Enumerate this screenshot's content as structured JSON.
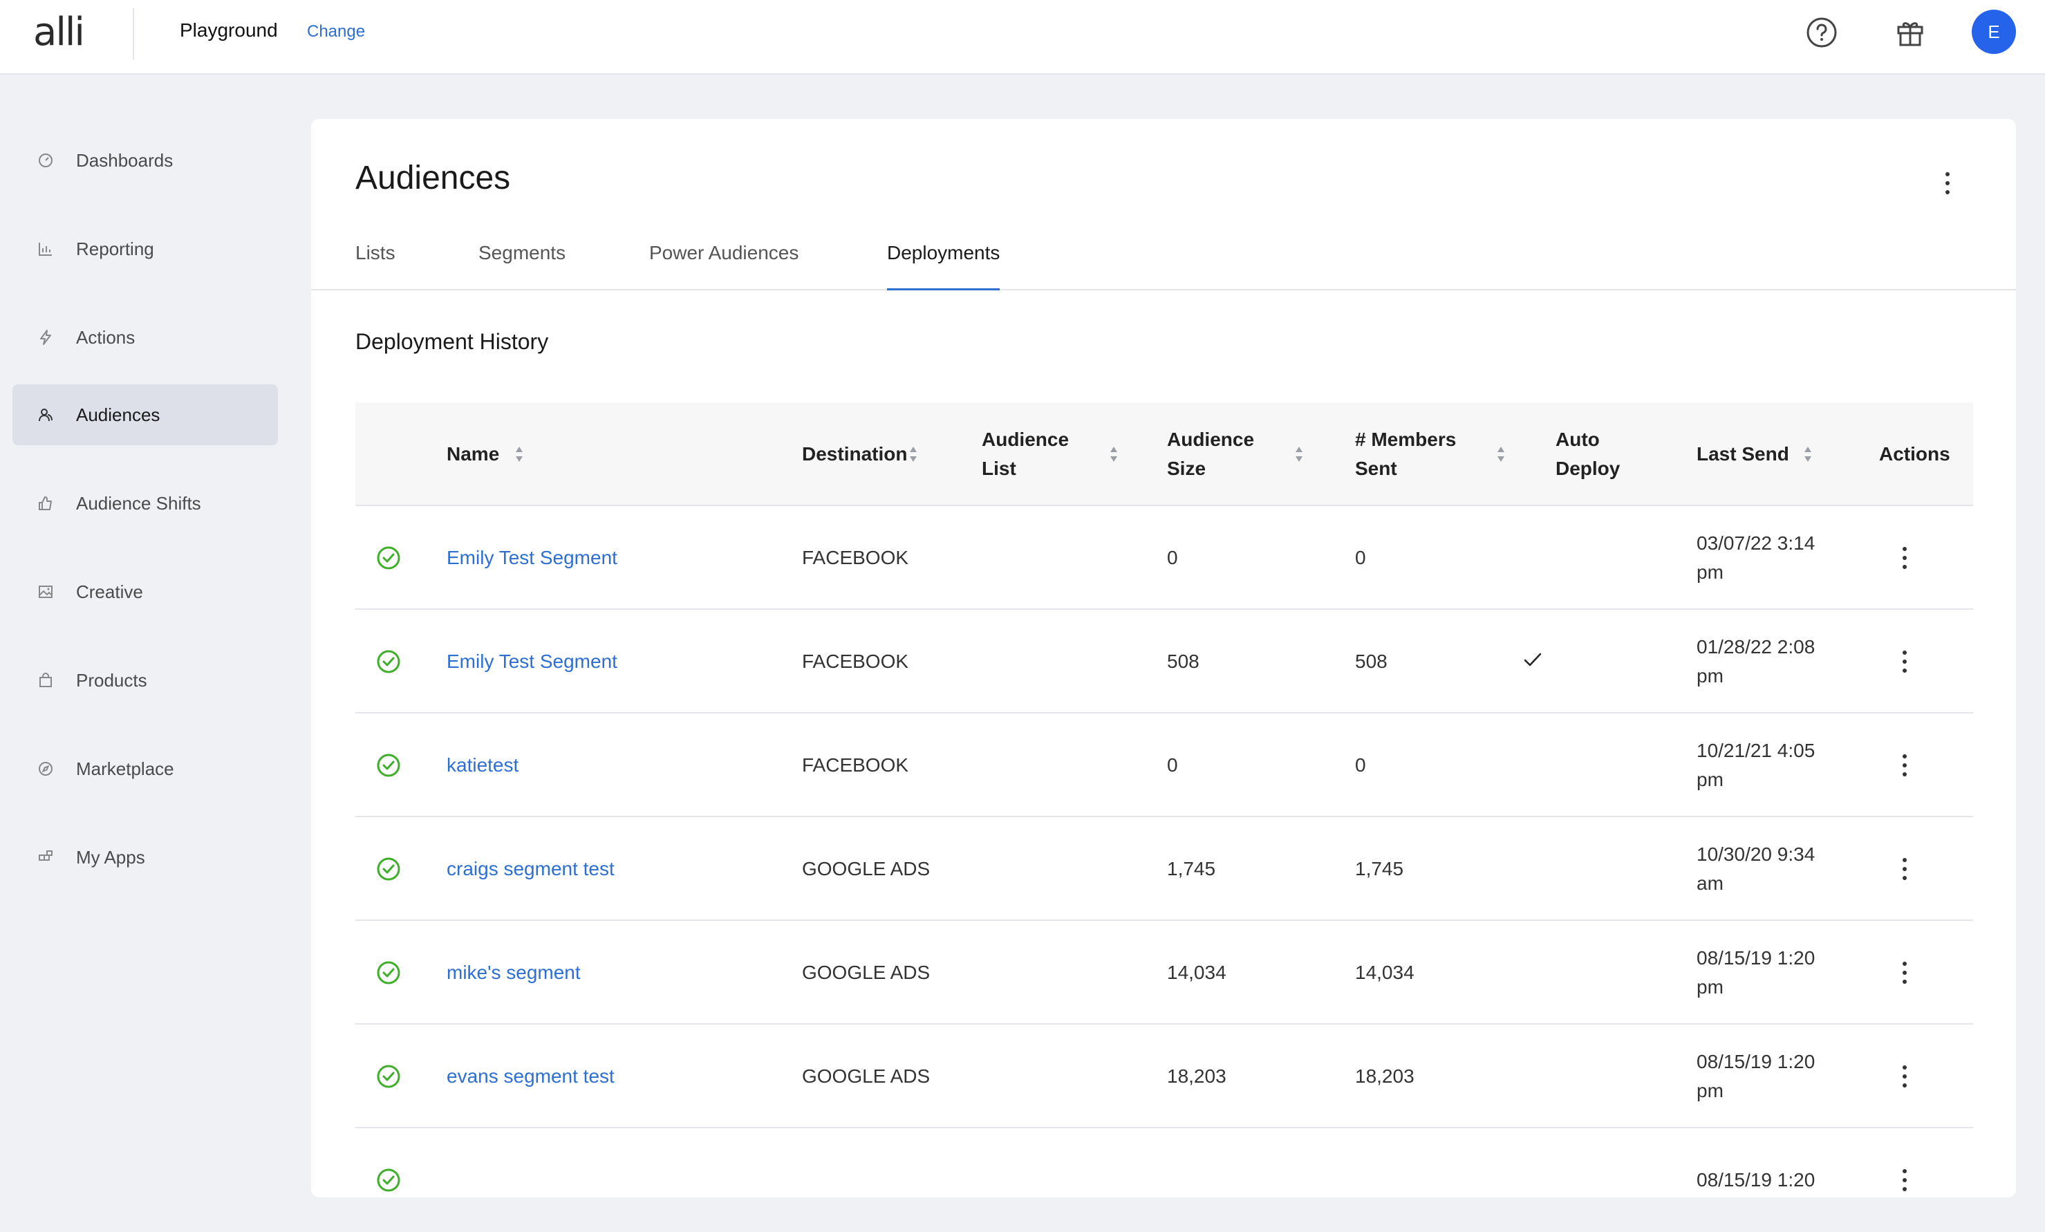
{
  "header": {
    "logo": "alli",
    "workspace": "Playground",
    "change_label": "Change",
    "avatar_initial": "E",
    "icons": [
      "help-icon",
      "gift-icon"
    ]
  },
  "sidebar": {
    "items": [
      {
        "label": "Dashboards",
        "icon": "dashboard-icon"
      },
      {
        "label": "Reporting",
        "icon": "bar-chart-icon"
      },
      {
        "label": "Actions",
        "icon": "lightning-icon"
      },
      {
        "label": "Audiences",
        "icon": "users-icon",
        "active": true
      },
      {
        "label": "Audience Shifts",
        "icon": "thumbs-up-icon"
      },
      {
        "label": "Creative",
        "icon": "image-icon"
      },
      {
        "label": "Products",
        "icon": "bag-icon"
      },
      {
        "label": "Marketplace",
        "icon": "compass-icon"
      },
      {
        "label": "My Apps",
        "icon": "apps-icon"
      }
    ]
  },
  "main": {
    "title": "Audiences",
    "tabs": [
      {
        "label": "Lists"
      },
      {
        "label": "Segments"
      },
      {
        "label": "Power Audiences"
      },
      {
        "label": "Deployments",
        "active": true
      }
    ],
    "section_title": "Deployment History"
  },
  "table": {
    "columns": [
      {
        "label": "Name",
        "sortable": true
      },
      {
        "label": "Destination",
        "sortable": true
      },
      {
        "label": "Audience List",
        "sortable": true
      },
      {
        "label": "Audience Size",
        "sortable": true
      },
      {
        "label": "# Members Sent",
        "sortable": true
      },
      {
        "label": "Auto Deploy",
        "sortable": false
      },
      {
        "label": "Last Send",
        "sortable": true
      },
      {
        "label": "Actions",
        "sortable": false
      }
    ],
    "rows": [
      {
        "name": "Emily Test Segment",
        "destination": "FACEBOOK",
        "audience_list": "",
        "size": "0",
        "members_sent": "0",
        "auto_deploy": false,
        "last_send": "03/07/22 3:14 pm"
      },
      {
        "name": "Emily Test Segment",
        "destination": "FACEBOOK",
        "audience_list": "",
        "size": "508",
        "members_sent": "508",
        "auto_deploy": true,
        "last_send": "01/28/22 2:08 pm"
      },
      {
        "name": "katietest",
        "destination": "FACEBOOK",
        "audience_list": "",
        "size": "0",
        "members_sent": "0",
        "auto_deploy": false,
        "last_send": "10/21/21 4:05 pm"
      },
      {
        "name": "craigs segment test",
        "destination": "GOOGLE ADS",
        "audience_list": "",
        "size": "1,745",
        "members_sent": "1,745",
        "auto_deploy": false,
        "last_send": "10/30/20 9:34 am"
      },
      {
        "name": "mike's segment",
        "destination": "GOOGLE ADS",
        "audience_list": "",
        "size": "14,034",
        "members_sent": "14,034",
        "auto_deploy": false,
        "last_send": "08/15/19 1:20 pm"
      },
      {
        "name": "evans segment test",
        "destination": "GOOGLE ADS",
        "audience_list": "",
        "size": "18,203",
        "members_sent": "18,203",
        "auto_deploy": false,
        "last_send": "08/15/19 1:20 pm"
      },
      {
        "name": "",
        "destination": "",
        "audience_list": "",
        "size": "",
        "members_sent": "",
        "auto_deploy": false,
        "last_send": "08/15/19 1:20"
      }
    ]
  },
  "colors": {
    "accent": "#2d6fd2",
    "success": "#3fae2a",
    "avatar": "#2563eb",
    "background": "#f0f1f5"
  }
}
